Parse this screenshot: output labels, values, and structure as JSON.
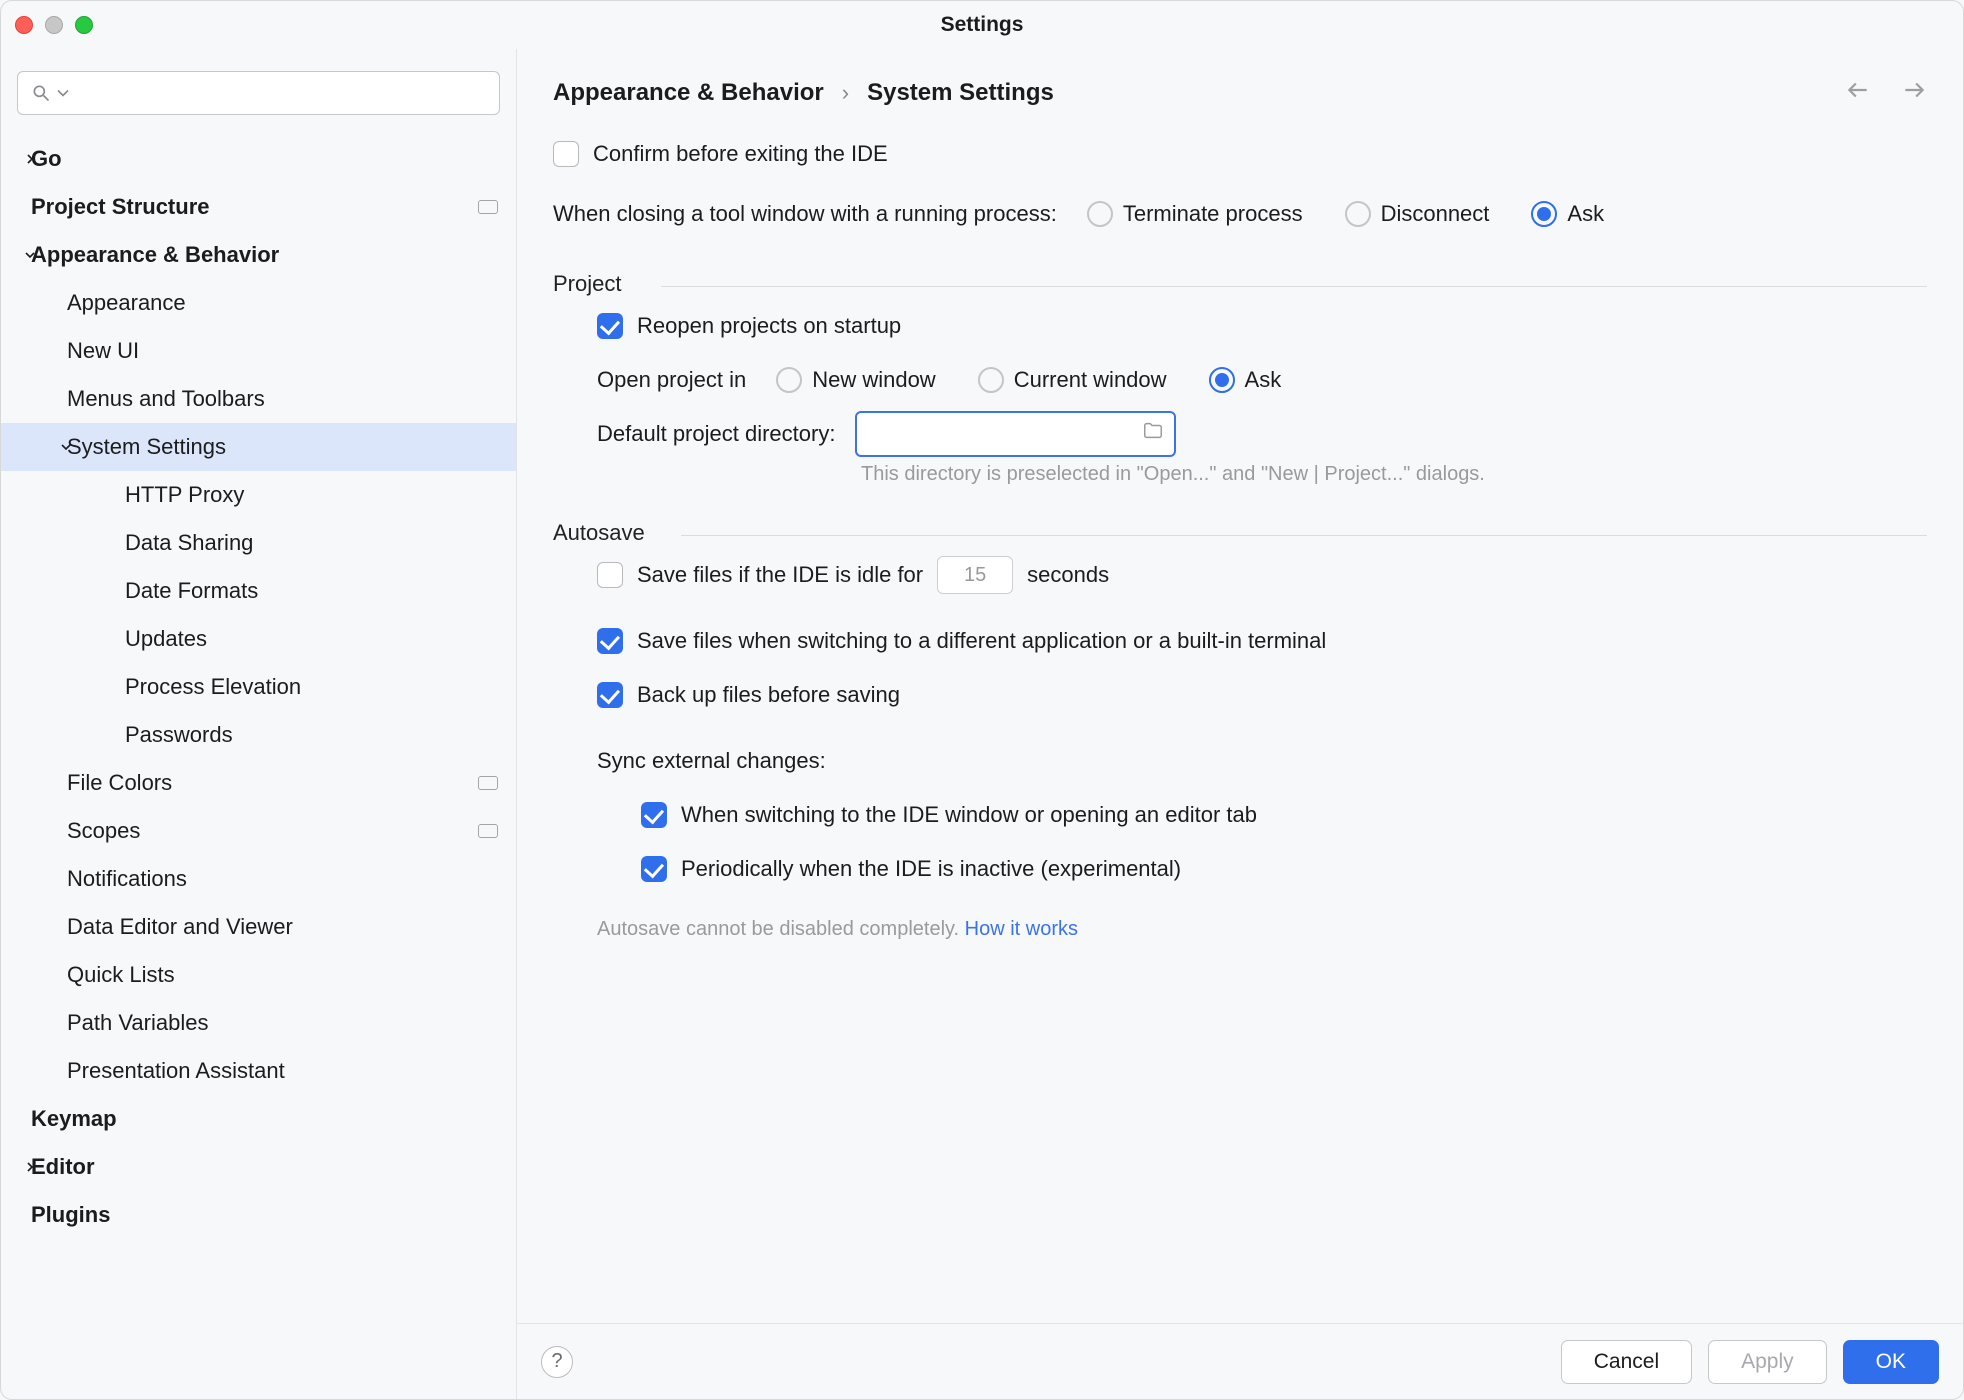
{
  "window": {
    "title": "Settings"
  },
  "sidebar": {
    "search_placeholder": "",
    "items": [
      {
        "label": "Go",
        "level": 0,
        "bold": true,
        "expander": "right"
      },
      {
        "label": "Project Structure",
        "level": 0,
        "bold": true,
        "trailing_pill": true
      },
      {
        "label": "Appearance & Behavior",
        "level": 0,
        "bold": true,
        "expander": "down"
      },
      {
        "label": "Appearance",
        "level": 1
      },
      {
        "label": "New UI",
        "level": 1
      },
      {
        "label": "Menus and Toolbars",
        "level": 1
      },
      {
        "label": "System Settings",
        "level": 1,
        "expander": "down",
        "selected": true
      },
      {
        "label": "HTTP Proxy",
        "level": 2
      },
      {
        "label": "Data Sharing",
        "level": 2
      },
      {
        "label": "Date Formats",
        "level": 2
      },
      {
        "label": "Updates",
        "level": 2
      },
      {
        "label": "Process Elevation",
        "level": 2
      },
      {
        "label": "Passwords",
        "level": 2
      },
      {
        "label": "File Colors",
        "level": 1,
        "trailing_pill": true
      },
      {
        "label": "Scopes",
        "level": 1,
        "trailing_pill": true
      },
      {
        "label": "Notifications",
        "level": 1
      },
      {
        "label": "Data Editor and Viewer",
        "level": 1
      },
      {
        "label": "Quick Lists",
        "level": 1
      },
      {
        "label": "Path Variables",
        "level": 1
      },
      {
        "label": "Presentation Assistant",
        "level": 1
      },
      {
        "label": "Keymap",
        "level": 0,
        "bold": true
      },
      {
        "label": "Editor",
        "level": 0,
        "bold": true,
        "expander": "right"
      },
      {
        "label": "Plugins",
        "level": 0,
        "bold": true
      }
    ]
  },
  "breadcrumbs": {
    "parent": "Appearance & Behavior",
    "current": "System Settings"
  },
  "panel": {
    "confirm_exit_label": "Confirm before exiting the IDE",
    "confirm_exit_checked": false,
    "closing_tool_label": "When closing a tool window with a running process:",
    "closing_tool_options": {
      "terminate": "Terminate process",
      "disconnect": "Disconnect",
      "ask": "Ask"
    },
    "closing_tool_selected": "ask",
    "project_section": "Project",
    "reopen_label": "Reopen projects on startup",
    "reopen_checked": true,
    "open_project_label": "Open project in",
    "open_project_options": {
      "new": "New window",
      "current": "Current window",
      "ask": "Ask"
    },
    "open_project_selected": "ask",
    "default_dir_label": "Default project directory:",
    "default_dir_value": "",
    "default_dir_hint": "This directory is preselected in \"Open...\" and \"New | Project...\" dialogs.",
    "autosave_section": "Autosave",
    "idle_label_pre": "Save files if the IDE is idle for",
    "idle_label_post": "seconds",
    "idle_value": "15",
    "idle_checked": false,
    "switch_label": "Save files when switching to a different application or a built-in terminal",
    "switch_checked": true,
    "backup_label": "Back up files before saving",
    "backup_checked": true,
    "sync_label": "Sync external changes:",
    "sync_opt1_label": "When switching to the IDE window or opening an editor tab",
    "sync_opt1_checked": true,
    "sync_opt2_label": "Periodically when the IDE is inactive (experimental)",
    "sync_opt2_checked": true,
    "autosave_note_prefix": "Autosave cannot be disabled completely. ",
    "autosave_note_link": "How it works"
  },
  "footer": {
    "cancel": "Cancel",
    "apply": "Apply",
    "ok": "OK"
  }
}
